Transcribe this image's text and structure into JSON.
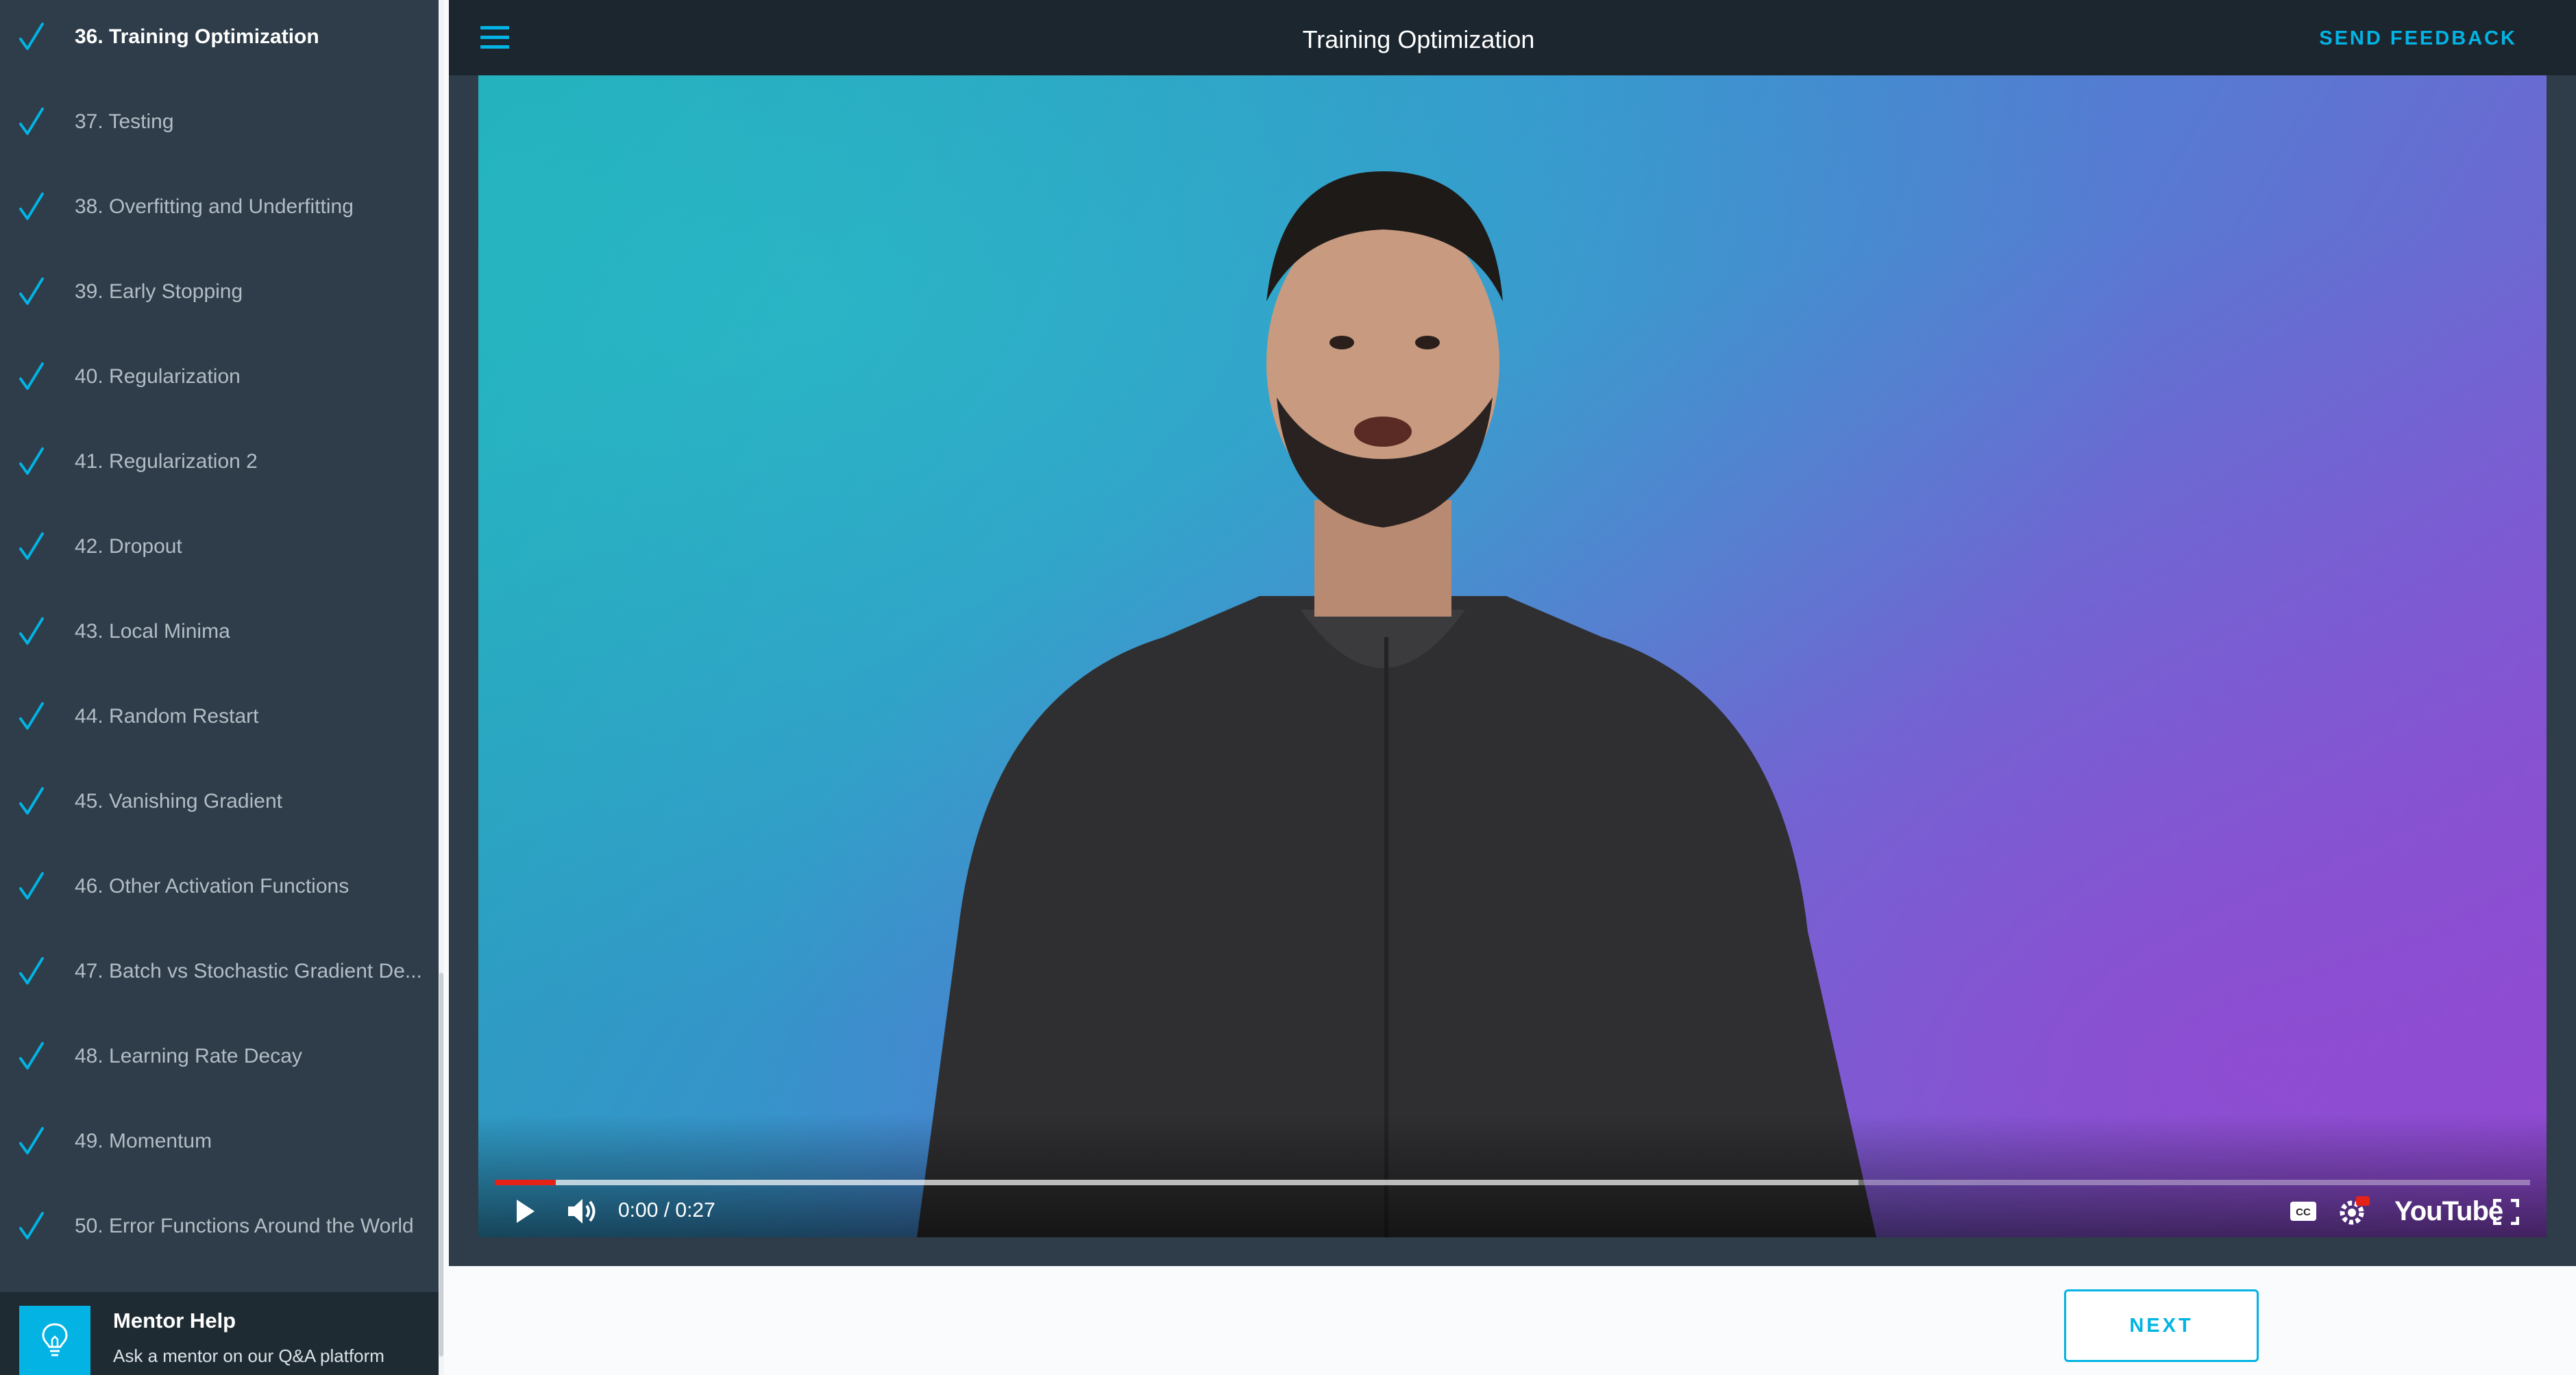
{
  "sidebar": {
    "items": [
      {
        "label": "36. Training Optimization",
        "completed": true,
        "active": true
      },
      {
        "label": "37. Testing",
        "completed": true
      },
      {
        "label": "38. Overfitting and Underfitting",
        "completed": true
      },
      {
        "label": "39. Early Stopping",
        "completed": true
      },
      {
        "label": "40. Regularization",
        "completed": true
      },
      {
        "label": "41. Regularization 2",
        "completed": true
      },
      {
        "label": "42. Dropout",
        "completed": true
      },
      {
        "label": "43. Local Minima",
        "completed": true
      },
      {
        "label": "44. Random Restart",
        "completed": true
      },
      {
        "label": "45. Vanishing Gradient",
        "completed": true
      },
      {
        "label": "46. Other Activation Functions",
        "completed": true
      },
      {
        "label": "47. Batch vs Stochastic Gradient De...",
        "completed": true
      },
      {
        "label": "48. Learning Rate Decay",
        "completed": true
      },
      {
        "label": "49. Momentum",
        "completed": true
      },
      {
        "label": "50. Error Functions Around the World",
        "completed": true
      }
    ],
    "mentor": {
      "title": "Mentor Help",
      "subtitle": "Ask a mentor on our Q&A platform",
      "icon": "lightbulb-icon"
    }
  },
  "header": {
    "title": "Training Optimization",
    "feedback_label": "SEND FEEDBACK",
    "menu_icon": "hamburger-icon"
  },
  "video": {
    "time": "0:00 / 0:27",
    "played_fraction": 0.03,
    "buffered_fraction": 0.67,
    "logo_text": "YouTube",
    "icons": [
      "play-icon",
      "volume-icon",
      "captions-icon",
      "settings-hd-icon",
      "youtube-logo",
      "fullscreen-icon"
    ]
  },
  "footer": {
    "next_label": "NEXT"
  },
  "colors": {
    "accent": "#02b3e4",
    "sidebar_bg": "#2e3d49",
    "topbar_bg": "#1c262f",
    "progress_played": "#e62117"
  }
}
